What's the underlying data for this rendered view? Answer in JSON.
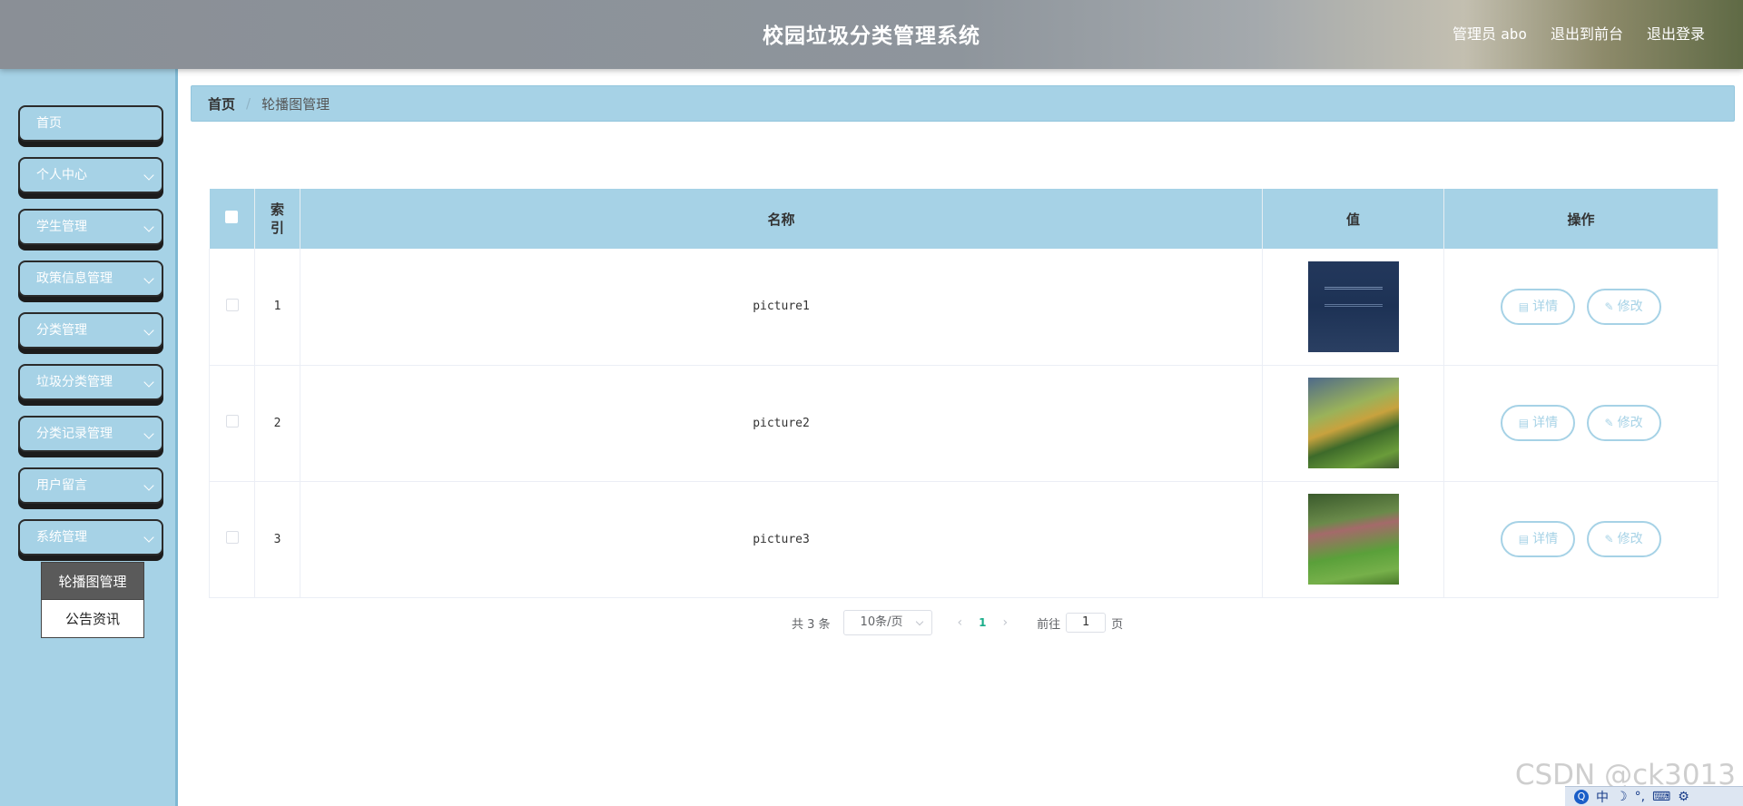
{
  "header": {
    "title": "校园垃圾分类管理系统",
    "admin_label": "管理员",
    "admin_name": "abo",
    "back_frontend": "退出到前台",
    "logout": "退出登录"
  },
  "sidebar": {
    "items": [
      {
        "label": "首页",
        "has_arrow": false
      },
      {
        "label": "个人中心",
        "has_arrow": true
      },
      {
        "label": "学生管理",
        "has_arrow": true
      },
      {
        "label": "政策信息管理",
        "has_arrow": true
      },
      {
        "label": "分类管理",
        "has_arrow": true
      },
      {
        "label": "垃圾分类管理",
        "has_arrow": true
      },
      {
        "label": "分类记录管理",
        "has_arrow": true
      },
      {
        "label": "用户留言",
        "has_arrow": true
      },
      {
        "label": "系统管理",
        "has_arrow": true
      }
    ],
    "submenu": [
      {
        "label": "轮播图管理",
        "active": true
      },
      {
        "label": "公告资讯",
        "active": false
      }
    ]
  },
  "breadcrumb": {
    "home": "首页",
    "current": "轮播图管理"
  },
  "table": {
    "headers": {
      "index": "索引",
      "name": "名称",
      "value": "值",
      "actions": "操作"
    },
    "rows": [
      {
        "index": "1",
        "name": "picture1"
      },
      {
        "index": "2",
        "name": "picture2"
      },
      {
        "index": "3",
        "name": "picture3"
      }
    ],
    "detail_label": "详情",
    "edit_label": "修改"
  },
  "pagination": {
    "total": "共 3 条",
    "page_size": "10条/页",
    "current_page": "1",
    "goto_label": "前往",
    "goto_value": "1",
    "page_unit": "页"
  },
  "watermark": "CSDN @ck3013",
  "tray": {
    "ime": "中"
  },
  "colors": {
    "theme_blue": "#a6d2e6",
    "active_page": "#1aad8a"
  }
}
